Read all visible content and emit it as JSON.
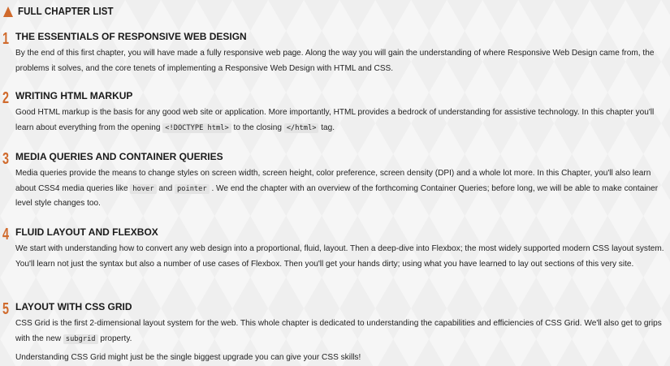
{
  "header": {
    "title": "FULL CHAPTER LIST"
  },
  "chapters": [
    {
      "number": "1",
      "title": "THE ESSENTIALS OF RESPONSIVE WEB DESIGN",
      "p1": "By the end of this first chapter, you will have made a fully responsive web page. Along the way you will gain the understanding of where Responsive Web Design came from, the problems it solves, and the core tenets of implementing a Responsive Web Design with HTML and CSS."
    },
    {
      "number": "2",
      "title": "WRITING HTML MARKUP",
      "p1_a": "Good HTML markup is the basis for any good web site or application. More importantly, HTML provides a bedrock of understanding for assistive technology. In this chapter you'll learn about everything from the opening ",
      "code1": "<!DOCTYPE html>",
      "p1_b": " to the closing ",
      "code2": "</html>",
      "p1_c": " tag."
    },
    {
      "number": "3",
      "title": "MEDIA QUERIES AND CONTAINER QUERIES",
      "p1_a": "Media queries provide the means to change styles on screen width, screen height, color preference, screen density (DPI) and a whole lot more. In this Chapter, you'll also learn about CSS4 media queries like ",
      "code1": "hover",
      "p1_b": " and ",
      "code2": "pointer",
      "p1_c": " . We end the chapter with an overview of the forthcoming Container Queries; before long, we will be able to make container level style changes too."
    },
    {
      "number": "4",
      "title": "FLUID LAYOUT AND FLEXBOX",
      "p1": "We start with understanding how to convert any web design into a proportional, fluid, layout. Then a deep-dive into Flexbox; the most widely supported modern CSS layout system. You'll learn not just the syntax but also a number of use cases of Flexbox. Then you'll get your hands dirty; using what you have learned to lay out sections of this very site."
    },
    {
      "number": "5",
      "title": "LAYOUT WITH CSS GRID",
      "p1_a": "CSS Grid is the first 2-dimensional layout system for the web. This whole chapter is dedicated to understanding the capabilities and efficiencies of CSS Grid. We'll also get to grips with the new ",
      "code1": "subgrid",
      "p1_b": " property.",
      "p2": "Understanding CSS Grid might just be the single biggest upgrade you can give your CSS skills!"
    }
  ]
}
